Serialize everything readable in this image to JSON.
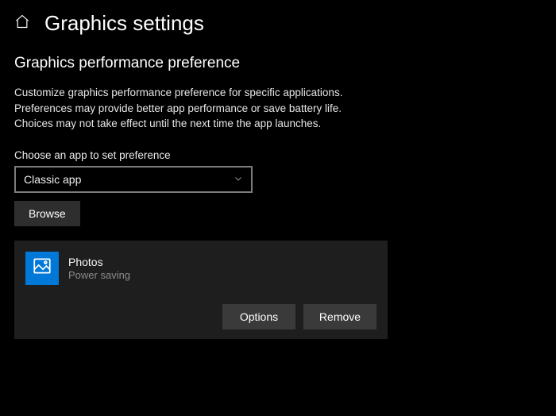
{
  "header": {
    "title": "Graphics settings"
  },
  "section": {
    "heading": "Graphics performance preference",
    "description": "Customize graphics performance preference for specific applications. Preferences may provide better app performance or save battery life. Choices may not take effect until the next time the app launches."
  },
  "picker": {
    "label": "Choose an app to set preference",
    "selected": "Classic app",
    "browse_label": "Browse"
  },
  "apps": [
    {
      "icon": "photos-icon",
      "name": "Photos",
      "preference": "Power saving"
    }
  ],
  "card_actions": {
    "options_label": "Options",
    "remove_label": "Remove"
  }
}
